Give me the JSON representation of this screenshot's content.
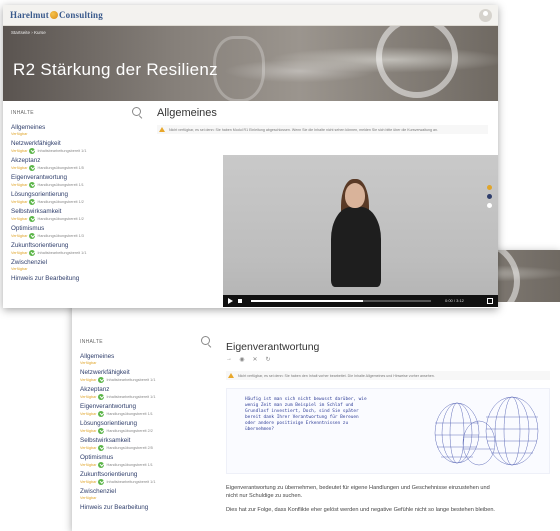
{
  "brand": {
    "logo_left": "Harelmut",
    "logo_right": "Consulting"
  },
  "front": {
    "breadcrumb": "Startseite › Kurse",
    "hero_title": "R2 Stärkung der Resilienz",
    "sidebar": {
      "title": "INHALTE",
      "items": [
        {
          "label": "Allgemeines",
          "meta": "Verfügbar",
          "status": "",
          "has_check": false
        },
        {
          "label": "Netzwerkfähigkeit",
          "meta": "Verfügbar",
          "status": "Inhaltsbearbeitungsbereit 1/1",
          "has_check": true
        },
        {
          "label": "Akzeptanz",
          "meta": "Verfügbar",
          "status": "Handlungsübungsbereit 1/5",
          "has_check": true
        },
        {
          "label": "Eigenverantwortung",
          "meta": "Verfügbar",
          "status": "Handlungsübungsbereit 1/1",
          "has_check": true
        },
        {
          "label": "Lösungsorientierung",
          "meta": "Verfügbar",
          "status": "Handlungsübungsbereit 1/2",
          "has_check": true
        },
        {
          "label": "Selbstwirksamkeit",
          "meta": "Verfügbar",
          "status": "Handlungsübungsbereit 1/2",
          "has_check": true
        },
        {
          "label": "Optimismus",
          "meta": "Verfügbar",
          "status": "Handlungsübungsbereit 1/3",
          "has_check": true
        },
        {
          "label": "Zukunftsorientierung",
          "meta": "Verfügbar",
          "status": "Inhaltsbearbeitungsbereit 1/1",
          "has_check": true
        },
        {
          "label": "Zwischenziel",
          "meta": "Verfügbar",
          "status": "",
          "has_check": false
        },
        {
          "label": "Hinweis zur Bearbeitung",
          "meta": "",
          "status": "",
          "has_check": false
        }
      ]
    },
    "main_title": "Allgemeines",
    "warning": "Nicht verfügbar, es sei denn: Sie haben Modul R1 Einleitung abgeschlossen. Wenn Sie die Inhalte nicht sehen können, melden Sie sich bitte über die Kursverwaltung an.",
    "video": {
      "progress": 0.62,
      "time": "0:00 / 3:12"
    }
  },
  "back": {
    "sidebar": {
      "title": "INHALTE",
      "items": [
        {
          "label": "Allgemeines",
          "meta": "Verfügbar",
          "status": "",
          "has_check": false
        },
        {
          "label": "Netzwerkfähigkeit",
          "meta": "Verfügbar",
          "status": "Inhaltsbearbeitungsbereit 1/1",
          "has_check": true
        },
        {
          "label": "Akzeptanz",
          "meta": "Verfügbar",
          "status": "Inhaltsbearbeitungsbereit 1/1",
          "has_check": true
        },
        {
          "label": "Eigenverantwortung",
          "meta": "Verfügbar",
          "status": "Handlungsübungsbereit 1/1",
          "has_check": true
        },
        {
          "label": "Lösungsorientierung",
          "meta": "Verfügbar",
          "status": "Handlungsübungsbereit 2/2",
          "has_check": true
        },
        {
          "label": "Selbstwirksamkeit",
          "meta": "Verfügbar",
          "status": "Handlungsübungsbereit 2/5",
          "has_check": true
        },
        {
          "label": "Optimismus",
          "meta": "Verfügbar",
          "status": "Handlungsübungsbereit 1/1",
          "has_check": true
        },
        {
          "label": "Zukunftsorientierung",
          "meta": "Verfügbar",
          "status": "Inhaltsbearbeitungsbereit 1/1",
          "has_check": true
        },
        {
          "label": "Zwischenziel",
          "meta": "Verfügbar",
          "status": "",
          "has_check": false
        },
        {
          "label": "Hinweis zur Bearbeitung",
          "meta": "",
          "status": "",
          "has_check": false
        }
      ]
    },
    "main_title": "Eigenverantwortung",
    "toolbar": {
      "prev": "→",
      "view": "◉",
      "close": "✕",
      "refresh": "↻"
    },
    "warning": "Nicht verfügbar, es sei denn: Sie haben den Inhalt vorher bearbeitet. Die Inhalte Allgemeines und Hinweise vorher ansehen.",
    "quote": "Häufig ist man sich nicht bewusst darüber, wie wenig Zeit man zum Beispiel im Schlaf und Grundlasf investiert, Doch, sind Sie später bereit dank Ihrer Verantwortung für Bereuen oder andere positivige Erkenntnissen zu übernehmen?",
    "paragraph1": "Eigenverantwortung zu übernehmen, bedeutet für eigene Handlungen und Geschehnisse einzustehen und nicht nur Schuldige zu suchen.",
    "paragraph2": "Dies hat zur Folge, dass Konflikte eher gelöst werden und negative Gefühle nicht so lange bestehen bleiben."
  },
  "colors": {
    "nav_link": "#2f3e6b",
    "meta": "#e0a52a",
    "check": "#5bb548",
    "warning": "#e8a72b"
  }
}
